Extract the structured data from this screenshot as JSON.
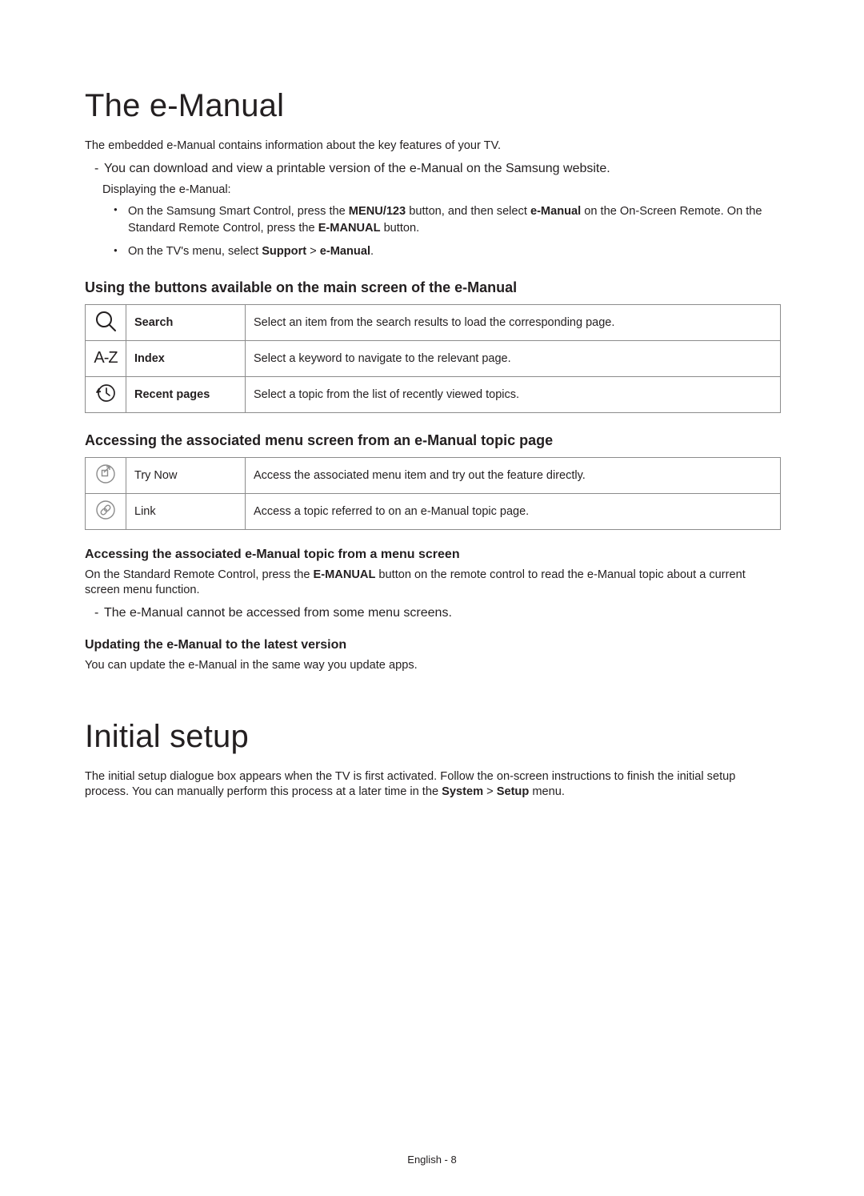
{
  "section1": {
    "title": "The e-Manual",
    "intro": "The embedded e-Manual contains information about the key features of your TV.",
    "note1": "You can download and view a printable version of the e-Manual on the Samsung website.",
    "displaying": "Displaying the e-Manual:",
    "bullet1a": "On the Samsung Smart Control, press the ",
    "bullet1b": " button, and then select ",
    "bullet1c": " on the On-Screen Remote. On the Standard Remote Control, press the ",
    "bullet1d": " button.",
    "bullet2a": "On the TV's menu, select ",
    "bullet2b": ".",
    "bold_menu123": "MENU/123",
    "bold_emanual_lc": "e-Manual",
    "bold_emanual_uc": "E-MANUAL",
    "bold_support": "Support",
    "gt": " > "
  },
  "subA": {
    "heading": "Using the buttons available on the main screen of the e-Manual",
    "rows": [
      {
        "label": "Search",
        "desc": "Select an item from the search results to load the corresponding page."
      },
      {
        "label": "Index",
        "desc": "Select a keyword to navigate to the relevant page."
      },
      {
        "label": "Recent pages",
        "desc": "Select a topic from the list of recently viewed topics."
      }
    ]
  },
  "subB": {
    "heading": "Accessing the associated menu screen from an e-Manual topic page",
    "rows": [
      {
        "label": "Try Now",
        "desc": "Access the associated menu item and try out the feature directly."
      },
      {
        "label": "Link",
        "desc": "Access a topic referred to on an e-Manual topic page."
      }
    ]
  },
  "subC": {
    "heading": "Accessing the associated e-Manual topic from a menu screen",
    "p1a": "On the Standard Remote Control, press the ",
    "p1b": " button on the remote control to read the e-Manual topic about a current screen menu function.",
    "note": "The e-Manual cannot be accessed from some menu screens."
  },
  "subD": {
    "heading": "Updating the e-Manual to the latest version",
    "p": "You can update the e-Manual in the same way you update apps."
  },
  "section2": {
    "title": "Initial setup",
    "p1a": "The initial setup dialogue box appears when the TV is first activated. Follow the on-screen instructions to finish the initial setup process. You can manually perform this process at a later time in the ",
    "p1b": " menu.",
    "bold_system": "System",
    "bold_setup": "Setup"
  },
  "footer": {
    "lang": "English",
    "sep": " - ",
    "page": "8"
  }
}
